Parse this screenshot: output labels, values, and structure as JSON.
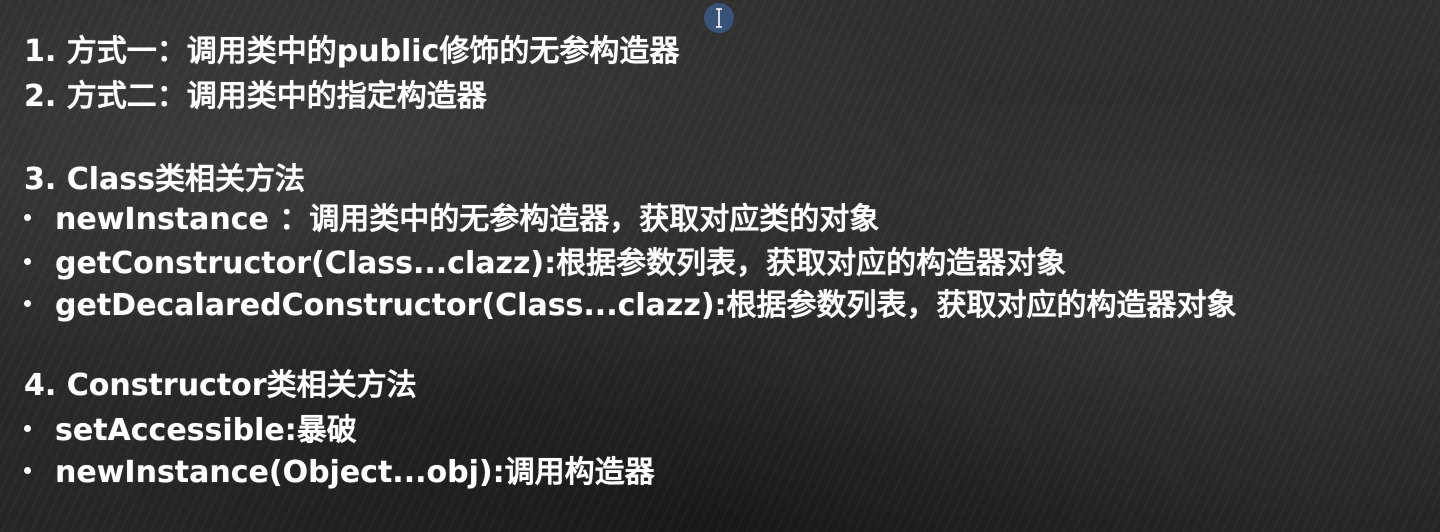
{
  "lines": [
    "1. 方式一：调用类中的public修饰的无参构造器",
    "2. 方式二：调用类中的指定构造器",
    "3. Class类相关方法"
  ],
  "class_methods": [
    "newInstance ：调用类中的无参构造器，获取对应类的对象",
    "getConstructor(Class...clazz):根据参数列表，获取对应的构造器对象",
    "getDecalaredConstructor(Class...clazz):根据参数列表，获取对应的构造器对象"
  ],
  "constructor_heading": "4. Constructor类相关方法",
  "constructor_methods": [
    "setAccessible:暴破",
    "newInstance(Object...obj):调用构造器"
  ],
  "colors": {
    "text": "#ffffff",
    "board": "#2b2b2b",
    "cursor_highlight": "#3c6eaf"
  },
  "icons": {
    "cursor": "text-cursor-icon"
  }
}
